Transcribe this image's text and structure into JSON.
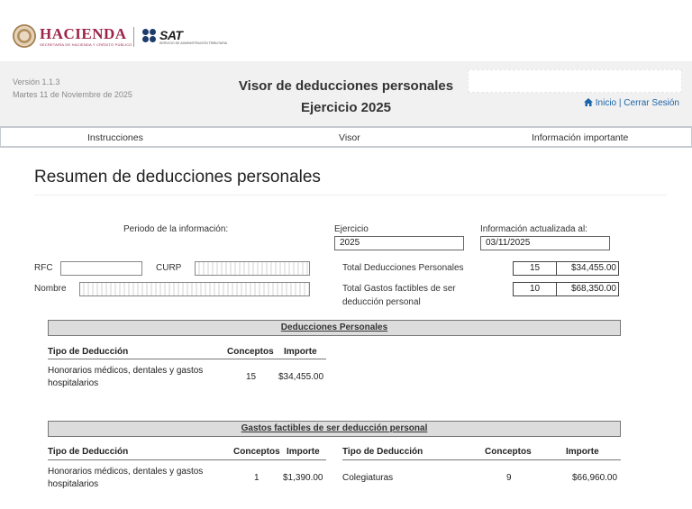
{
  "logos": {
    "hacienda": "HACIENDA",
    "hacienda_sub": "SECRETARÍA DE HACIENDA Y CRÉDITO PÚBLICO",
    "sat": "SAT",
    "sat_sub": "SERVICIO DE ADMINISTRACIÓN TRIBUTARIA"
  },
  "header": {
    "version": "Versión 1.1.3",
    "date": "Martes 11 de Noviembre de 2025",
    "title": "Visor de deducciones personales",
    "subtitle": "Ejercicio 2025",
    "link_inicio": "Inicio",
    "separator": "|",
    "link_cerrar": "Cerrar Sesión"
  },
  "nav": {
    "instrucciones": "Instrucciones",
    "visor": "Visor",
    "informacion": "Información importante"
  },
  "summary": {
    "title": "Resumen de deducciones personales",
    "periodo_label": "Periodo de la información:",
    "ejercicio_label": "Ejercicio",
    "ejercicio_value": "2025",
    "actualizada_label": "Información actualizada al:",
    "actualizada_value": "03/11/2025",
    "rfc_label": "RFC",
    "curp_label": "CURP",
    "nombre_label": "Nombre",
    "total_ded_label": "Total Deducciones Personales",
    "total_ded_count": "15",
    "total_ded_amount": "$34,455.00",
    "total_gastos_label_1": "Total Gastos factibles de ser",
    "total_gastos_label_2": "deducción personal",
    "total_gastos_count": "10",
    "total_gastos_amount": "$68,350.00"
  },
  "deducciones_table": {
    "title": "Deducciones Personales",
    "headers": [
      "Tipo de Deducción",
      "Conceptos",
      "Importe"
    ],
    "rows": [
      {
        "tipo_1": "Honorarios médicos, dentales y gastos",
        "tipo_2": "hospitalarios",
        "conceptos": "15",
        "importe": "$34,455.00"
      }
    ]
  },
  "gastos_table": {
    "title": "Gastos factibles de ser deducción personal",
    "headers": [
      "Tipo de Deducción",
      "Conceptos",
      "Importe",
      "Tipo de Deducción",
      "Conceptos",
      "Importe"
    ],
    "left": {
      "tipo_1": "Honorarios médicos, dentales y gastos",
      "tipo_2": "hospitalarios",
      "conceptos": "1",
      "importe": "$1,390.00"
    },
    "right": {
      "tipo": "Colegiaturas",
      "conceptos": "9",
      "importe": "$66,960.00"
    }
  },
  "colors": {
    "brand": "#9d2449",
    "link": "#1a64a8",
    "band": "#dcdcdc"
  }
}
